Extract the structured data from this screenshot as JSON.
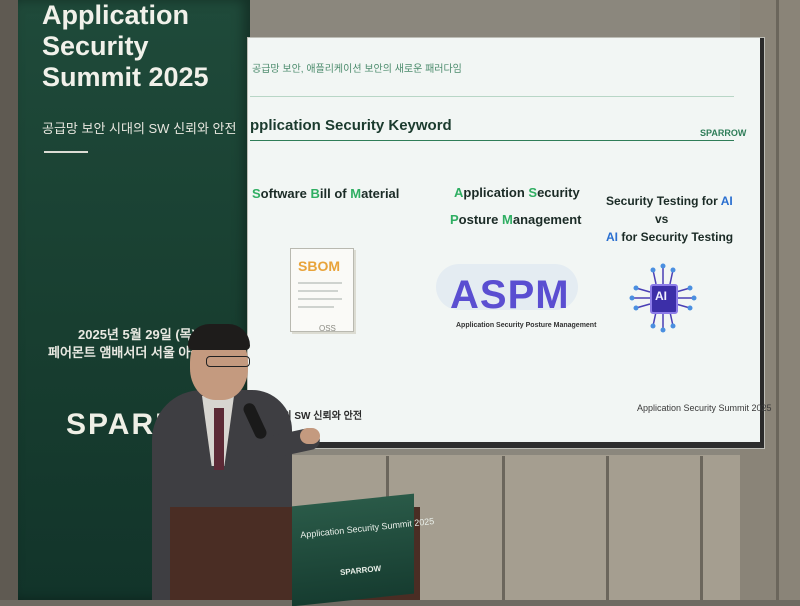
{
  "banner": {
    "title_lines": [
      "Application",
      "Security",
      "Summit 2025"
    ],
    "subtitle": "공급망 보안 시대의 SW 신뢰와 안전",
    "date": "2025년 5월 29일 (목)",
    "venue": "페어몬트 앰배서더 서울 아잘",
    "logo": "SPARRO"
  },
  "slide": {
    "breadcrumb": "공급망 보안, 애플리케이션 보안의 새로운 패러다임",
    "title": "pplication Security Keyword",
    "brand": "SPARROW",
    "kw1": {
      "s": "S",
      "oftware": "oftware ",
      "b": "B",
      "ill": "ill of  ",
      "m": "M",
      "aterial": "aterial"
    },
    "kw2_line1": {
      "a": "A",
      "pplication": "pplication ",
      "s": "S",
      "ecurity": "ecurity"
    },
    "kw2_line2": {
      "p": "P",
      "osture": "osture ",
      "m": "M",
      "anagement": "anagement"
    },
    "kw3_line1": {
      "text": "Security Testing for ",
      "ai": "AI"
    },
    "kw3_vs": "vs",
    "kw3_line2": {
      "ai": "AI",
      "text": " for Security Testing"
    },
    "sbom_label": "SBOM",
    "oss_label": "OSS",
    "aspm_label": "ASPM",
    "aspm_sub": "Application Security Posture Management",
    "ai_chip": "AI",
    "footer_left": "안 시대의 SW 신뢰와 안전",
    "footer_right": "Application Security Summit 2025"
  },
  "podium": {
    "title": "Application Security Summit 2025",
    "logo": "SPARROW"
  },
  "colors": {
    "banner_green": "#1f4a3a",
    "keyword_green": "#2fae62",
    "aspm_purple": "#5a4ed1",
    "ai_blue": "#2a6fd0"
  }
}
